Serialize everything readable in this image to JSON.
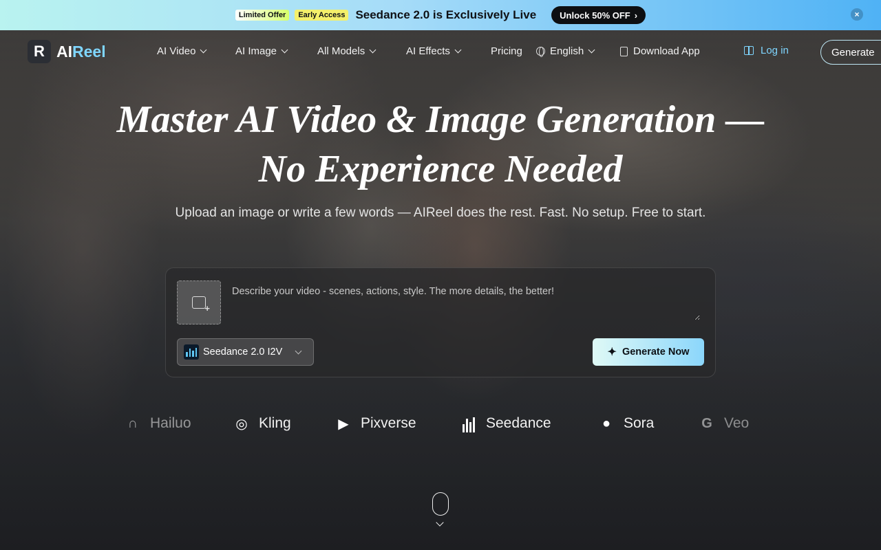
{
  "promo": {
    "badge_limited": "Limited Offer",
    "badge_early": "Early Access",
    "text": "Seedance 2.0 is Exclusively Live",
    "cta": "Unlock 50% OFF",
    "cta_arrow": "›",
    "close": "×"
  },
  "header": {
    "logo_mark": "R",
    "logo_ai": "AI",
    "logo_reel": "Reel",
    "nav": [
      {
        "label": "AI Video"
      },
      {
        "label": "AI Image"
      },
      {
        "label": "All Models"
      },
      {
        "label": "AI Effects"
      },
      {
        "label": "Pricing"
      }
    ],
    "language": "English",
    "download": "Download App",
    "login": "Log in",
    "generate": "Generate"
  },
  "hero": {
    "title": "Master AI Video & Image Generation — No Experience Needed",
    "subtitle": "Upload an image or write a few words — AIReel does the rest. Fast. No setup. Free to start."
  },
  "prompt_card": {
    "placeholder": "Describe your video - scenes, actions, style. The more details, the better!",
    "model": "Seedance 2.0 I2V",
    "generate_label": "Generate Now"
  },
  "models": [
    {
      "name": "Hailuo",
      "icon": "hailuo-icon"
    },
    {
      "name": "Kling",
      "icon": "kling-icon"
    },
    {
      "name": "Pixverse",
      "icon": "pixverse-icon"
    },
    {
      "name": "Seedance",
      "icon": "seedance-icon"
    },
    {
      "name": "Sora",
      "icon": "sora-icon"
    },
    {
      "name": "Veo",
      "icon": "google-icon"
    }
  ],
  "colors": {
    "accent": "#7fd6ff",
    "promo_gradient_start": "#b9f3f0",
    "promo_gradient_end": "#4fb2f5",
    "cta_dark": "#0d0f12"
  }
}
